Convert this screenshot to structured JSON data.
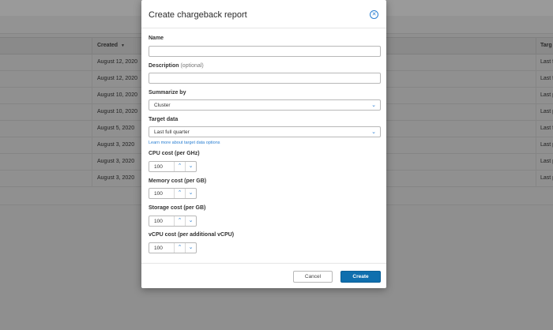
{
  "background": {
    "table": {
      "col_created": "Created",
      "col_created_sort_icon": "sort-desc-icon",
      "col_target": "Targ",
      "rows": [
        {
          "created": "August 12, 2020",
          "target": "Last f"
        },
        {
          "created": "August 12, 2020",
          "target": "Last f"
        },
        {
          "created": "August 10, 2020",
          "target": "Last p"
        },
        {
          "created": "August 10, 2020",
          "target": "Last p"
        },
        {
          "created": "August 5, 2020",
          "target": "Last f"
        },
        {
          "created": "August 3, 2020",
          "target": "Last p"
        },
        {
          "created": "August 3, 2020",
          "target": "Last p"
        },
        {
          "created": "August 3, 2020",
          "target": "Last p"
        }
      ]
    }
  },
  "modal": {
    "title": "Create chargeback report",
    "close_icon": "close-circle-icon",
    "name": {
      "label": "Name",
      "value": ""
    },
    "description": {
      "label": "Description",
      "optional": "(optional)",
      "value": ""
    },
    "summarize_by": {
      "label": "Summarize by",
      "value": "Cluster"
    },
    "target_data": {
      "label": "Target data",
      "value": "Last full quarter",
      "help_link": "Learn more about target data options"
    },
    "cpu_cost": {
      "label": "CPU cost (per GHz)",
      "value": "100"
    },
    "memory_cost": {
      "label": "Memory cost (per GB)",
      "value": "100"
    },
    "storage_cost": {
      "label": "Storage cost (per GB)",
      "value": "100"
    },
    "vcpu_cost": {
      "label": "vCPU cost (per additional vCPU)",
      "value": "100"
    },
    "cancel_label": "Cancel",
    "create_label": "Create"
  },
  "colors": {
    "accent": "#2a7fd2",
    "primary_button": "#0f6fae",
    "overlay": "#8f8f8f"
  }
}
